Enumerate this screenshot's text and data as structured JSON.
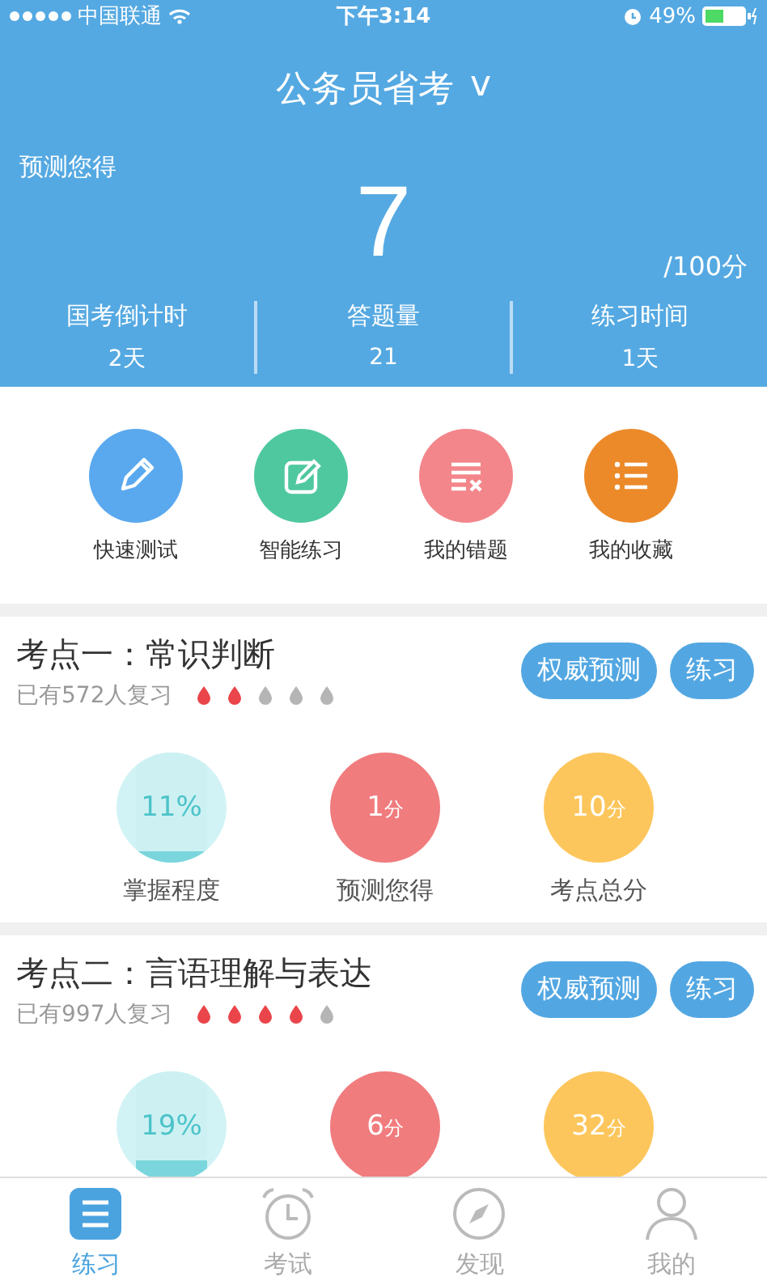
{
  "status_bar": {
    "carrier": "中国联通",
    "time": "下午3:14",
    "battery": "49%"
  },
  "header": {
    "title": "公务员省考",
    "dropdown": "v",
    "predict_label": "预测您得",
    "score": "7",
    "total": "/100分",
    "stats": [
      {
        "label": "国考倒计时",
        "value": "2天"
      },
      {
        "label": "答题量",
        "value": "21"
      },
      {
        "label": "练习时间",
        "value": "1天"
      }
    ]
  },
  "actions": [
    {
      "kind": "pencil",
      "label": "快速测试",
      "color": "#5aa9ef"
    },
    {
      "kind": "edit",
      "label": "智能练习",
      "color": "#4fc8a0"
    },
    {
      "kind": "wrong",
      "label": "我的错题",
      "color": "#f3868b"
    },
    {
      "kind": "list",
      "label": "我的收藏",
      "color": "#ec8a2a"
    }
  ],
  "topics": [
    {
      "title": "考点一：常识判断",
      "reviewers": "已有572人复习",
      "stars": 2,
      "buttons": [
        "权威预测",
        "练习"
      ],
      "metrics": [
        {
          "kind": "mastery",
          "value": "11%",
          "level": 0.11,
          "label": "掌握程度"
        },
        {
          "kind": "predicted",
          "value": "1",
          "unit": "分",
          "label": "预测您得"
        },
        {
          "kind": "total",
          "value": "10",
          "unit": "分",
          "label": "考点总分"
        }
      ]
    },
    {
      "title": "考点二：言语理解与表达",
      "reviewers": "已有997人复习",
      "stars": 4,
      "buttons": [
        "权威预测",
        "练习"
      ],
      "metrics": [
        {
          "kind": "mastery",
          "value": "19%",
          "level": 0.19
        },
        {
          "kind": "predicted",
          "value": "6",
          "unit": "分"
        },
        {
          "kind": "total",
          "value": "32",
          "unit": "分"
        }
      ]
    }
  ],
  "tabs": [
    {
      "kind": "list",
      "label": "练习",
      "selected": true
    },
    {
      "kind": "clock",
      "label": "考试",
      "selected": false
    },
    {
      "kind": "compass",
      "label": "发现",
      "selected": false
    },
    {
      "kind": "person",
      "label": "我的",
      "selected": false
    }
  ]
}
